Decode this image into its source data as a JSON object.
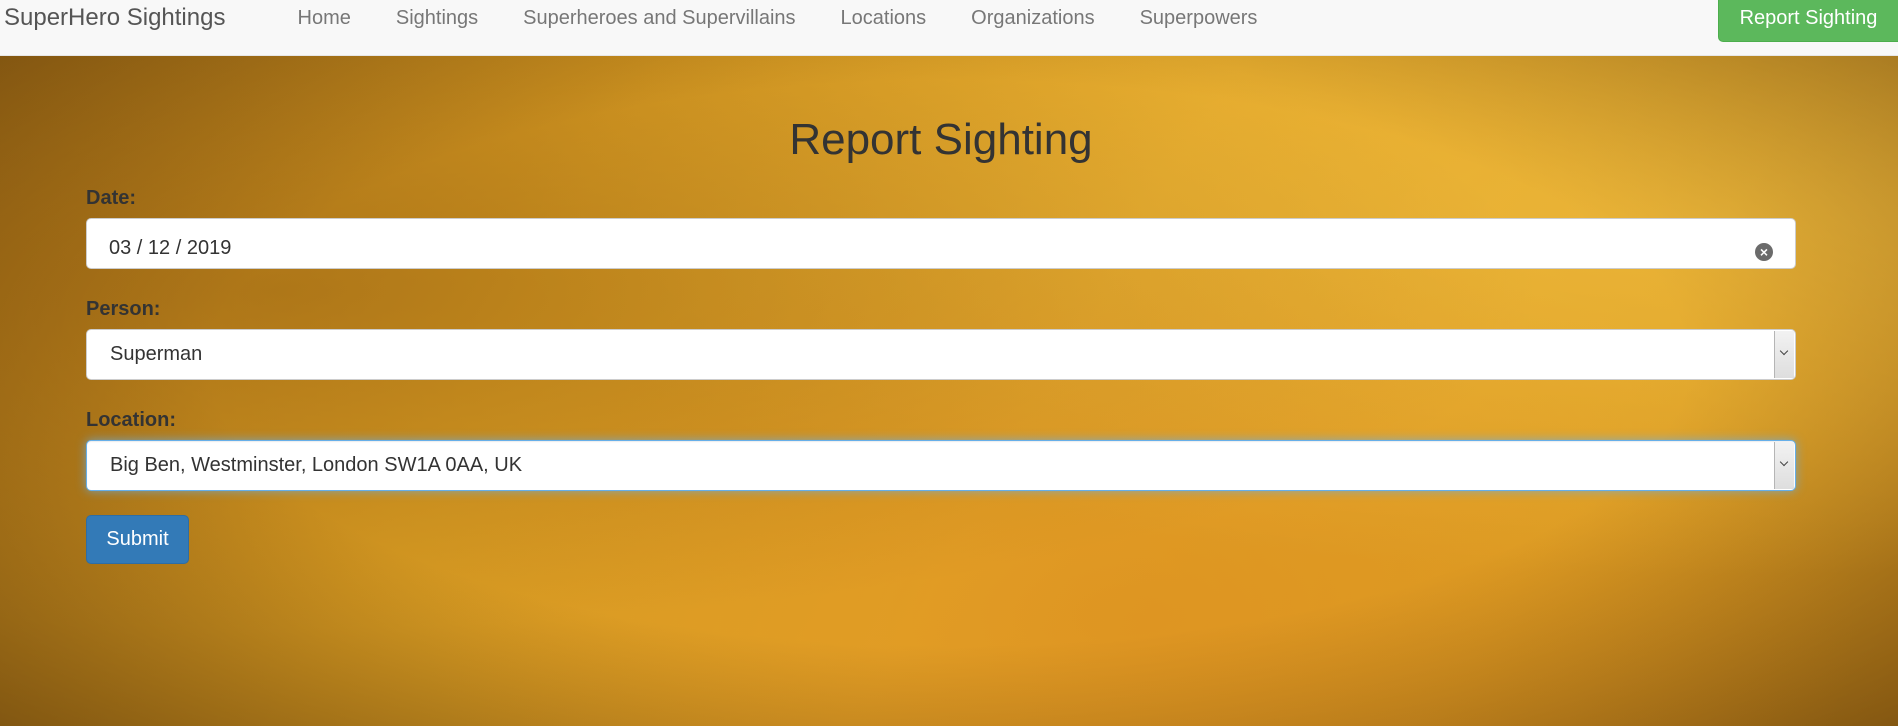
{
  "app": {
    "brand": "SuperHero Sightings"
  },
  "nav": {
    "items": [
      {
        "label": "Home"
      },
      {
        "label": "Sightings"
      },
      {
        "label": "Superheroes and Supervillains"
      },
      {
        "label": "Locations"
      },
      {
        "label": "Organizations"
      },
      {
        "label": "Superpowers"
      }
    ],
    "report_label": "Report Sighting"
  },
  "page": {
    "title": "Report Sighting"
  },
  "form": {
    "date": {
      "label": "Date:",
      "value": "03 / 12 / 2019"
    },
    "person": {
      "label": "Person:",
      "value": "Superman"
    },
    "location": {
      "label": "Location:",
      "value": "Big Ben, Westminster, London SW1A 0AA, UK"
    },
    "submit_label": "Submit"
  },
  "colors": {
    "submit": "#337ab7",
    "report_button": "#5cb85c",
    "focus_ring": "#66afe9",
    "background": "#d69a22"
  },
  "icons": {
    "clear": "clear-icon",
    "select": "chevron-down-icon"
  }
}
